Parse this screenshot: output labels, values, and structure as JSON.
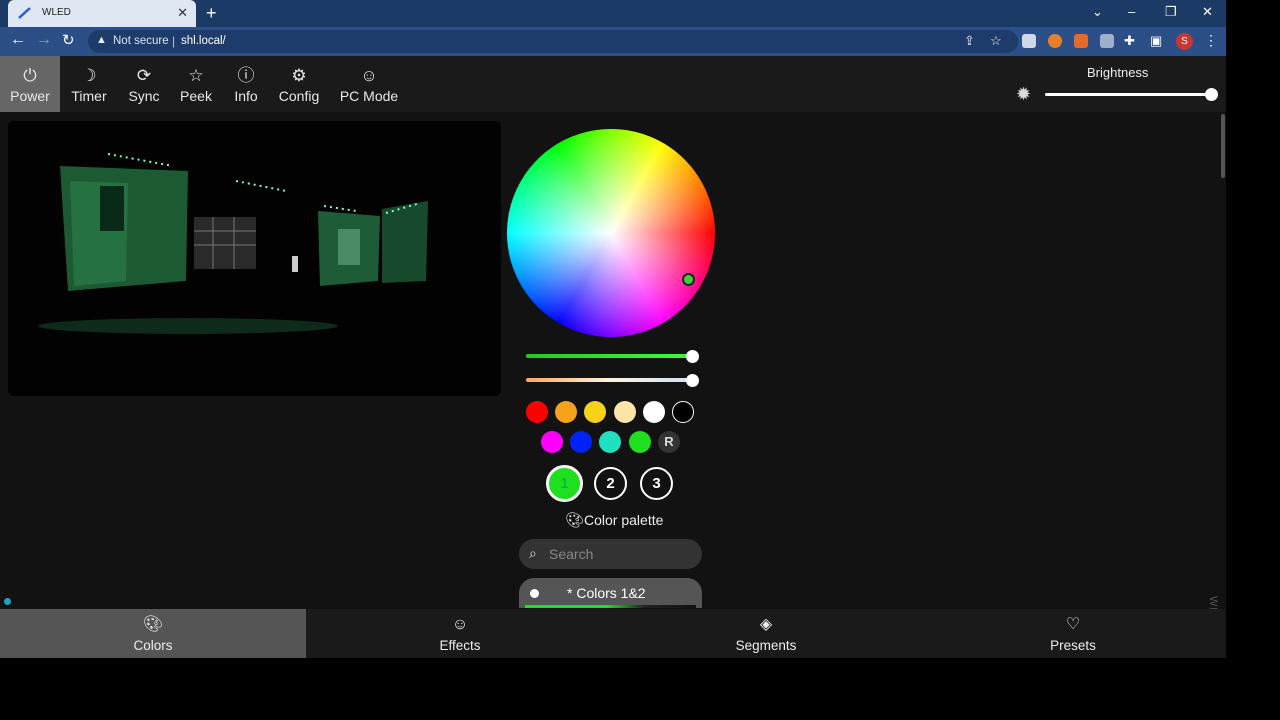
{
  "browser": {
    "tab_title": "WLED",
    "tab_close": "✕",
    "new_tab": "+",
    "security_label": "Not secure",
    "url": "shl.local/",
    "profile_initial": "S",
    "icons": [
      "back-arrow-icon",
      "forward-arrow-icon",
      "reload-icon",
      "warning-icon",
      "share-icon",
      "star-icon",
      "puzzle-icon",
      "sidepanel-icon",
      "kebab-menu-icon"
    ]
  },
  "topnav": {
    "items": [
      {
        "label": "Power",
        "icon": "power-icon",
        "active": true
      },
      {
        "label": "Timer",
        "icon": "moon-icon"
      },
      {
        "label": "Sync",
        "icon": "sync-icon"
      },
      {
        "label": "Peek",
        "icon": "star-icon"
      },
      {
        "label": "Info",
        "icon": "info-icon"
      },
      {
        "label": "Config",
        "icon": "gear-icon"
      },
      {
        "label": "PC Mode",
        "icon": "smiley-icon"
      }
    ],
    "brightness_label": "Brightness",
    "brightness_fraction": 1.0
  },
  "colors": {
    "picker_selected": "#3bd13b",
    "slider1_fraction": 1.0,
    "slider2_fraction": 1.0,
    "quick_colors_row1": [
      "#ff0000",
      "#f7a21b",
      "#f7d21b",
      "#fde5a8",
      "#ffffff"
    ],
    "quick_colors_row2": [
      "#ff00ff",
      "#0022ff",
      "#21e0c0",
      "#1fe01f"
    ],
    "random_label": "R",
    "slots": [
      "1",
      "2",
      "3"
    ],
    "active_slot": "1",
    "palette_title": "Color palette",
    "search_placeholder": "Search",
    "palette_selected": "* Colors 1&2"
  },
  "side_label": "WLED",
  "bottomnav": {
    "items": [
      {
        "label": "Colors",
        "icon": "palette-icon",
        "active": true
      },
      {
        "label": "Effects",
        "icon": "smiley-icon"
      },
      {
        "label": "Segments",
        "icon": "layers-icon"
      },
      {
        "label": "Presets",
        "icon": "heart-icon"
      }
    ]
  }
}
